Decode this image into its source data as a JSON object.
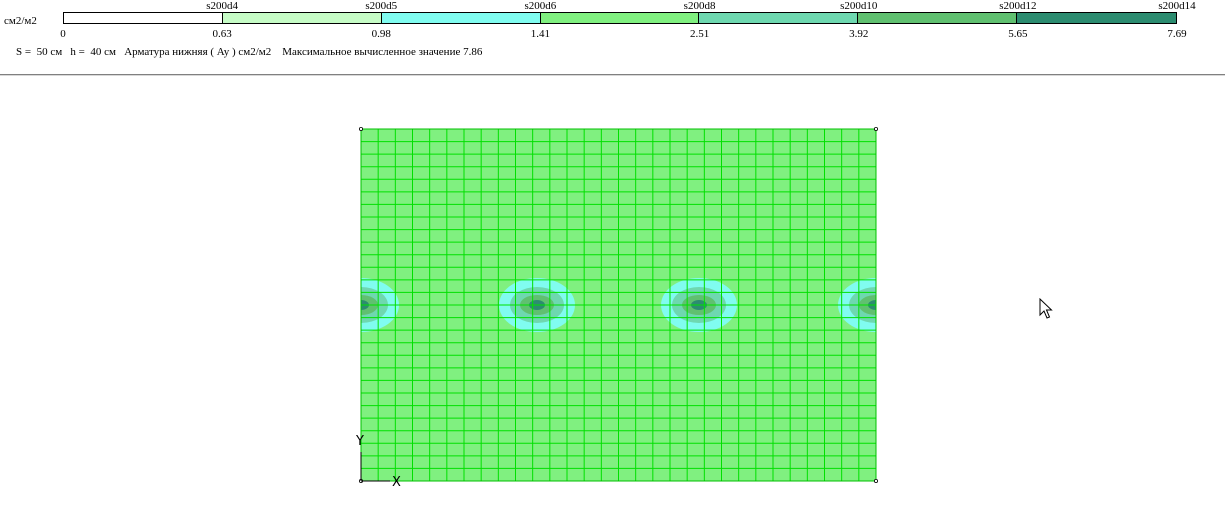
{
  "legend": {
    "unit": "см2/м2",
    "segments": [
      {
        "color": "#ffffff"
      },
      {
        "color": "#c6fcc6"
      },
      {
        "color": "#80fcf0"
      },
      {
        "color": "#80f080"
      },
      {
        "color": "#6ed8b0"
      },
      {
        "color": "#60c070"
      },
      {
        "color": "#2c8c70"
      }
    ],
    "top_labels": [
      "s200d4",
      "s200d5",
      "s200d6",
      "s200d8",
      "s200d10",
      "s200d12",
      "s200d14"
    ],
    "bottom_labels": [
      "0",
      "0.63",
      "0.98",
      "1.41",
      "2.51",
      "3.92",
      "5.65",
      "7.69"
    ]
  },
  "info_line": "S =  50 см   h =  40 см   Арматура нижняя ( Ay ) см2/м2    Максимальное вычисленное значение 7.86",
  "plot": {
    "base_color": "#80f080",
    "grid_color": "#00e000",
    "hotspot_colors": [
      "#80fcf0",
      "#6ed8b0",
      "#60c070",
      "#2c8c70"
    ],
    "axis_y": "Y",
    "axis_x": "X"
  }
}
